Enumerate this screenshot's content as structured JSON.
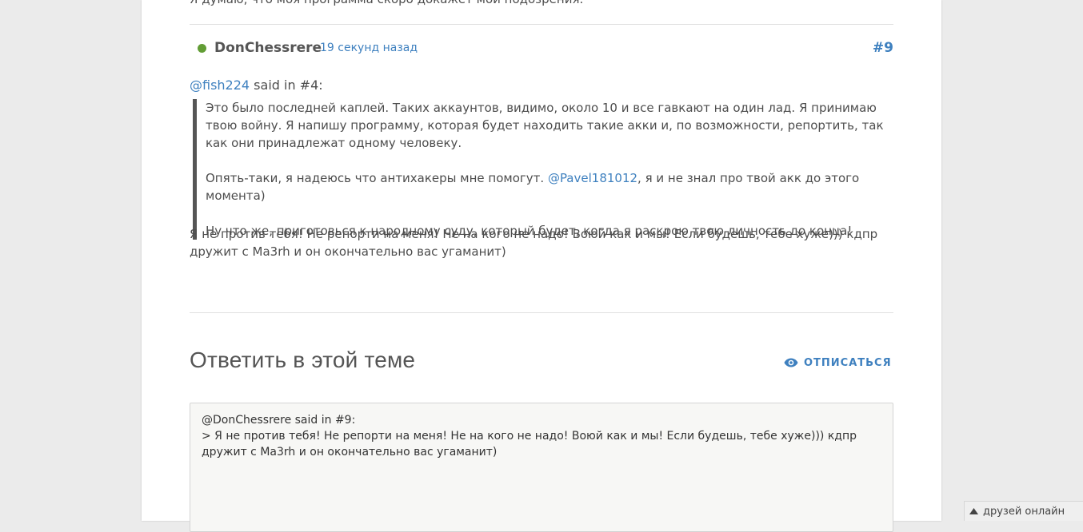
{
  "previous_post": {
    "text": "Я думаю, что моя программа скоро докажет мои подозрения."
  },
  "post": {
    "author": "DonChessrere",
    "time": "19 секунд назад",
    "number": "#9",
    "quote_header": {
      "mention": "@fish224",
      "said": " said in #4:"
    },
    "quote": {
      "p1": "Это было последней каплей. Таких аккаунтов, видимо, около 10 и все гавкают на один лад. Я принимаю твою войну. Я напишу программу, которая будет находить такие акки и, по возможности, репортить, так как они принадлежат одному человеку.",
      "p2_before": "Опять-таки, я надеюсь что антихакеры мне помогут. ",
      "p2_mention": "@Pavel181012",
      "p2_after": ", я и не знал про твой акк до этого момента)",
      "p3": "Ну что же, приготовься к народному суду, который будет, когда я раскрою твою личность до конца!"
    },
    "body": "Я не против тебя! Не репорти на меня! Не на кого не надо! Воюй как и мы! Если будешь, тебе хуже))) кдпр дружит с Ma3rh и он окончательно вас угаманит)"
  },
  "reply": {
    "title": "Ответить в этой теме",
    "unsubscribe_label": "ОТПИСАТЬСЯ",
    "composer_text": "@DonChessrere said in #9:\n> Я не против тебя! Не репорти на меня! Не на кого не надо! Воюй как и мы! Если будешь, тебе хуже))) кдпр дружит с Ma3rh и он окончательно вас угаманит)"
  },
  "friends_bar": {
    "label": "друзей онлайн"
  },
  "colors": {
    "link": "#3e80bf",
    "online": "#629d35",
    "background": "#ebebeb"
  },
  "icons": [
    "online-status-icon",
    "eye-icon",
    "triangle-up-icon"
  ]
}
